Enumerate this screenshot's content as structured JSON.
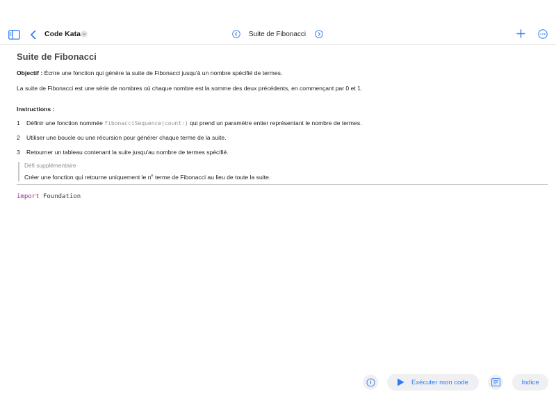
{
  "navbar": {
    "project_title": "Code Kata",
    "page_title": "Suite de Fibonacci"
  },
  "content": {
    "heading": "Suite de Fibonacci",
    "objective_label": "Objectif :",
    "objective_text": "Écrire une fonction qui génère la suite de Fibonacci jusqu'à un nombre spécifié de termes.",
    "description": "La suite de Fibonacci est une série de nombres où chaque nombre est la somme des deux précédents, en commençant par 0 et 1.",
    "instructions_title": "Instructions :",
    "steps": [
      {
        "num": "1",
        "before": "Définir une fonction nommée ",
        "code": "fibonacciSequence(count:)",
        "after": " qui prend un paramètre entier représentant le nombre de termes."
      },
      {
        "num": "2",
        "text": "Utiliser une boucle ou une récursion pour générer chaque terme de la suite."
      },
      {
        "num": "3",
        "text": "Retourner un tableau contenant la suite jusqu'au nombre de termes spécifié."
      }
    ],
    "challenge": {
      "title": "Défi supplémentaire",
      "text_before": "Créer une fonction qui retourne uniquement le n",
      "superscript": "e",
      "text_after": " terme de Fibonacci au lieu de toute la suite."
    }
  },
  "editor": {
    "keyword": "import",
    "module": "Foundation"
  },
  "toolbar": {
    "run_label": "Exécuter mon code",
    "hint_label": "Indice"
  },
  "colors": {
    "accent": "#2f7bf5",
    "keyword": "#9b2393"
  },
  "icons": [
    "sidebar-icon",
    "chevron-left-icon",
    "chevron-down-icon",
    "page-prev-icon",
    "page-next-icon",
    "plus-icon",
    "ellipsis-icon",
    "info-icon",
    "play-icon",
    "document-icon"
  ]
}
